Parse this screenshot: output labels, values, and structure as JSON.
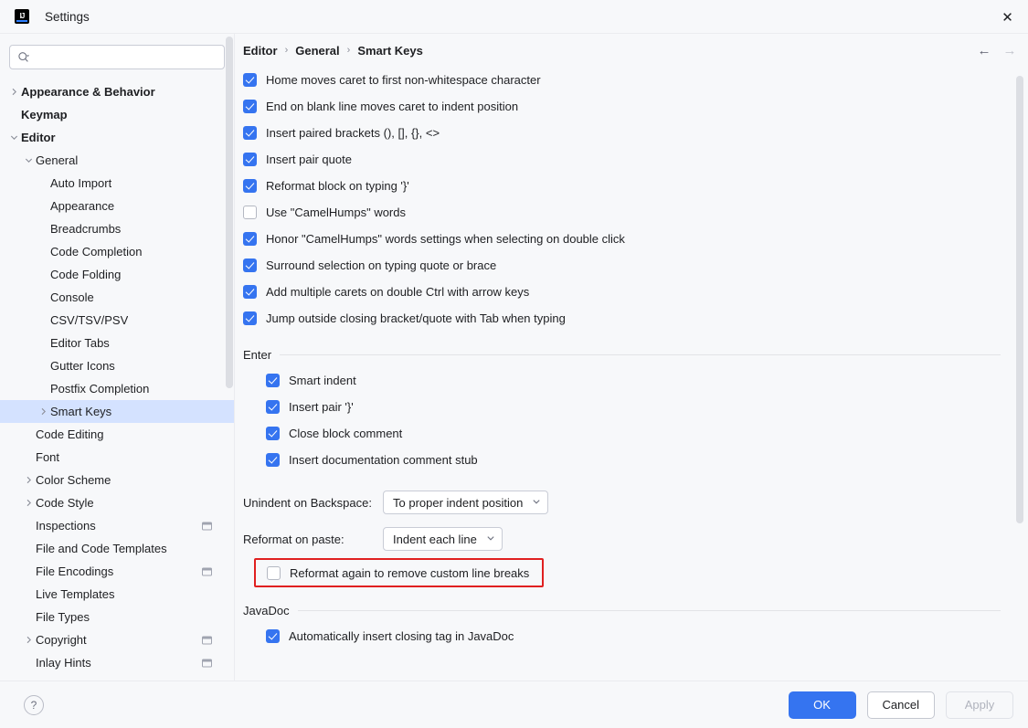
{
  "titlebar": {
    "logo_text": "IJ",
    "title": "Settings",
    "close_label": "✕"
  },
  "sidebar": {
    "search": {
      "value": "",
      "placeholder": "",
      "icon": "search-icon"
    },
    "items": [
      {
        "label": "Appearance & Behavior",
        "indent": 0,
        "arrow": "collapsed",
        "bold": true,
        "selected": false,
        "badge": false
      },
      {
        "label": "Keymap",
        "indent": 0,
        "arrow": "none",
        "bold": true,
        "selected": false,
        "badge": false
      },
      {
        "label": "Editor",
        "indent": 0,
        "arrow": "expanded",
        "bold": true,
        "selected": false,
        "badge": false
      },
      {
        "label": "General",
        "indent": 1,
        "arrow": "expanded",
        "bold": false,
        "selected": false,
        "badge": false
      },
      {
        "label": "Auto Import",
        "indent": 2,
        "arrow": "none",
        "bold": false,
        "selected": false,
        "badge": false
      },
      {
        "label": "Appearance",
        "indent": 2,
        "arrow": "none",
        "bold": false,
        "selected": false,
        "badge": false
      },
      {
        "label": "Breadcrumbs",
        "indent": 2,
        "arrow": "none",
        "bold": false,
        "selected": false,
        "badge": false
      },
      {
        "label": "Code Completion",
        "indent": 2,
        "arrow": "none",
        "bold": false,
        "selected": false,
        "badge": false
      },
      {
        "label": "Code Folding",
        "indent": 2,
        "arrow": "none",
        "bold": false,
        "selected": false,
        "badge": false
      },
      {
        "label": "Console",
        "indent": 2,
        "arrow": "none",
        "bold": false,
        "selected": false,
        "badge": false
      },
      {
        "label": "CSV/TSV/PSV",
        "indent": 2,
        "arrow": "none",
        "bold": false,
        "selected": false,
        "badge": false
      },
      {
        "label": "Editor Tabs",
        "indent": 2,
        "arrow": "none",
        "bold": false,
        "selected": false,
        "badge": false
      },
      {
        "label": "Gutter Icons",
        "indent": 2,
        "arrow": "none",
        "bold": false,
        "selected": false,
        "badge": false
      },
      {
        "label": "Postfix Completion",
        "indent": 2,
        "arrow": "none",
        "bold": false,
        "selected": false,
        "badge": false
      },
      {
        "label": "Smart Keys",
        "indent": 2,
        "arrow": "collapsed",
        "bold": false,
        "selected": true,
        "badge": false
      },
      {
        "label": "Code Editing",
        "indent": 1,
        "arrow": "none",
        "bold": false,
        "selected": false,
        "badge": false
      },
      {
        "label": "Font",
        "indent": 1,
        "arrow": "none",
        "bold": false,
        "selected": false,
        "badge": false
      },
      {
        "label": "Color Scheme",
        "indent": 1,
        "arrow": "collapsed",
        "bold": false,
        "selected": false,
        "badge": false
      },
      {
        "label": "Code Style",
        "indent": 1,
        "arrow": "collapsed",
        "bold": false,
        "selected": false,
        "badge": false
      },
      {
        "label": "Inspections",
        "indent": 1,
        "arrow": "none",
        "bold": false,
        "selected": false,
        "badge": true
      },
      {
        "label": "File and Code Templates",
        "indent": 1,
        "arrow": "none",
        "bold": false,
        "selected": false,
        "badge": false
      },
      {
        "label": "File Encodings",
        "indent": 1,
        "arrow": "none",
        "bold": false,
        "selected": false,
        "badge": true
      },
      {
        "label": "Live Templates",
        "indent": 1,
        "arrow": "none",
        "bold": false,
        "selected": false,
        "badge": false
      },
      {
        "label": "File Types",
        "indent": 1,
        "arrow": "none",
        "bold": false,
        "selected": false,
        "badge": false
      },
      {
        "label": "Copyright",
        "indent": 1,
        "arrow": "collapsed",
        "bold": false,
        "selected": false,
        "badge": true
      },
      {
        "label": "Inlay Hints",
        "indent": 1,
        "arrow": "none",
        "bold": false,
        "selected": false,
        "badge": true
      }
    ]
  },
  "content": {
    "breadcrumb": [
      "Editor",
      "General",
      "Smart Keys"
    ],
    "breadcrumb_separator": "›",
    "nav": {
      "back": "←",
      "forward": "→",
      "back_enabled": true,
      "forward_enabled": false
    },
    "top_options": [
      {
        "label": "Home moves caret to first non-whitespace character",
        "checked": true
      },
      {
        "label": "End on blank line moves caret to indent position",
        "checked": true
      },
      {
        "label": "Insert paired brackets (), [], {}, <>",
        "checked": true
      },
      {
        "label": "Insert pair quote",
        "checked": true
      },
      {
        "label": "Reformat block on typing '}'",
        "checked": true
      },
      {
        "label": "Use \"CamelHumps\" words",
        "checked": false
      },
      {
        "label": "Honor \"CamelHumps\" words settings when selecting on double click",
        "checked": true
      },
      {
        "label": "Surround selection on typing quote or brace",
        "checked": true
      },
      {
        "label": "Add multiple carets on double Ctrl with arrow keys",
        "checked": true
      },
      {
        "label": "Jump outside closing bracket/quote with Tab when typing",
        "checked": true
      }
    ],
    "enter_group": {
      "title": "Enter",
      "options": [
        {
          "label": "Smart indent",
          "checked": true
        },
        {
          "label": "Insert pair '}'",
          "checked": true
        },
        {
          "label": "Close block comment",
          "checked": true
        },
        {
          "label": "Insert documentation comment stub",
          "checked": true
        }
      ]
    },
    "fields": [
      {
        "label": "Unindent on Backspace:",
        "value": "To proper indent position"
      },
      {
        "label": "Reformat on paste:",
        "value": "Indent each line"
      }
    ],
    "highlighted_option": {
      "label": "Reformat again to remove custom line breaks",
      "checked": false,
      "highlight_color": "#e02020"
    },
    "javadoc_group": {
      "title": "JavaDoc",
      "options": [
        {
          "label": "Automatically insert closing tag in JavaDoc",
          "checked": true
        }
      ]
    }
  },
  "footer": {
    "help_label": "?",
    "ok_label": "OK",
    "cancel_label": "Cancel",
    "apply_label": "Apply",
    "apply_enabled": false,
    "accent_color": "#3574f0"
  }
}
